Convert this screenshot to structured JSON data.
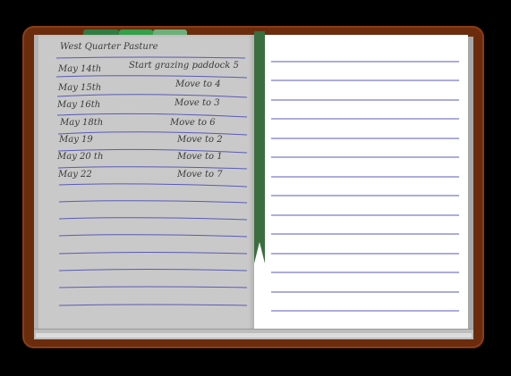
{
  "notebook": {
    "title": "West Quarter Pasture",
    "entries": [
      {
        "date": "May 14th",
        "note": "Start grazing paddock 5"
      },
      {
        "date": "May 15th",
        "note": "Move to 4"
      },
      {
        "date": "May 16th",
        "note": "Move to 3"
      },
      {
        "date": "May 18th",
        "note": "Move to 6"
      },
      {
        "date": "May 19",
        "note": "Move to 2"
      },
      {
        "date": "May 20 th",
        "note": "Move to 1"
      },
      {
        "date": "May 22",
        "note": "Move to 7"
      }
    ]
  },
  "colors": {
    "cover": "#6b2c0e",
    "ruled_line": "#5a5ab8",
    "ribbon": "#3b6e3f",
    "tab_dark": "#2f7d43",
    "tab_mid": "#33a04a",
    "tab_light": "#6fb07a"
  }
}
